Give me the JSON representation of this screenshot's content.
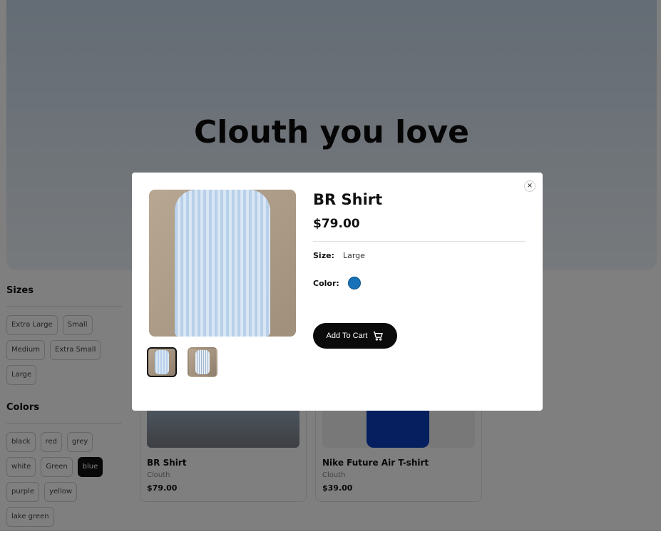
{
  "hero": {
    "title": "Clouth you love"
  },
  "filters": {
    "sizes": {
      "title": "Sizes",
      "options": [
        "Extra Large",
        "Small",
        "Medium",
        "Extra Small",
        "Large"
      ]
    },
    "colors": {
      "title": "Colors",
      "options": [
        "black",
        "red",
        "grey",
        "white",
        "Green",
        "blue",
        "purple",
        "yellow",
        "lake green"
      ],
      "selected": "blue"
    }
  },
  "products": [
    {
      "name": "BR Shirt",
      "brand": "Clouth",
      "price": "$79.00"
    },
    {
      "name": "Nike Future Air T-shirt",
      "brand": "Clouth",
      "price": "$39.00"
    }
  ],
  "modal": {
    "title": "BR Shirt",
    "price": "$79.00",
    "size_label": "Size:",
    "size_value": "Large",
    "color_label": "Color:",
    "color_value": "#1872b8",
    "add_to_cart_label": "Add To Cart",
    "close_icon": "×",
    "cart_icon": "shopping-cart-icon"
  }
}
